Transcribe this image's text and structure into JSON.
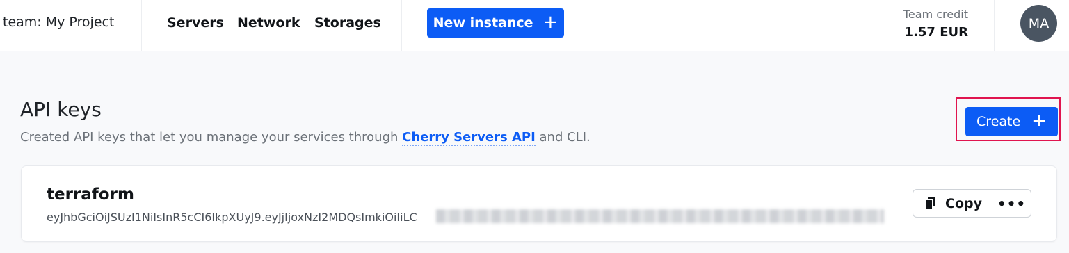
{
  "header": {
    "team_label": "team: My Project",
    "nav": [
      {
        "label": "Servers"
      },
      {
        "label": "Network"
      },
      {
        "label": "Storages"
      }
    ],
    "new_instance_label": "New instance",
    "credit_label": "Team credit",
    "credit_value": "1.57 EUR",
    "avatar_initials": "MA"
  },
  "page": {
    "title": "API keys",
    "desc_before": "Created API keys that let you manage your services through ",
    "desc_link": "Cherry Servers API",
    "desc_after": " and CLI.",
    "create_label": "Create"
  },
  "api_keys": [
    {
      "name": "terraform",
      "token_visible": "eyJhbGciOiJSUzI1NiIsInR5cCI6IkpXUyJ9.eyJjIjoxNzI2MDQsImkiOiIiLC",
      "copy_label": "Copy",
      "more_label": "•••"
    }
  ],
  "icons": {
    "plus": "plus-icon",
    "copy": "copy-icon",
    "more": "more-icon"
  },
  "colors": {
    "primary": "#0c5cf5",
    "highlight": "#e0154f",
    "avatar_bg": "#4a5562"
  }
}
